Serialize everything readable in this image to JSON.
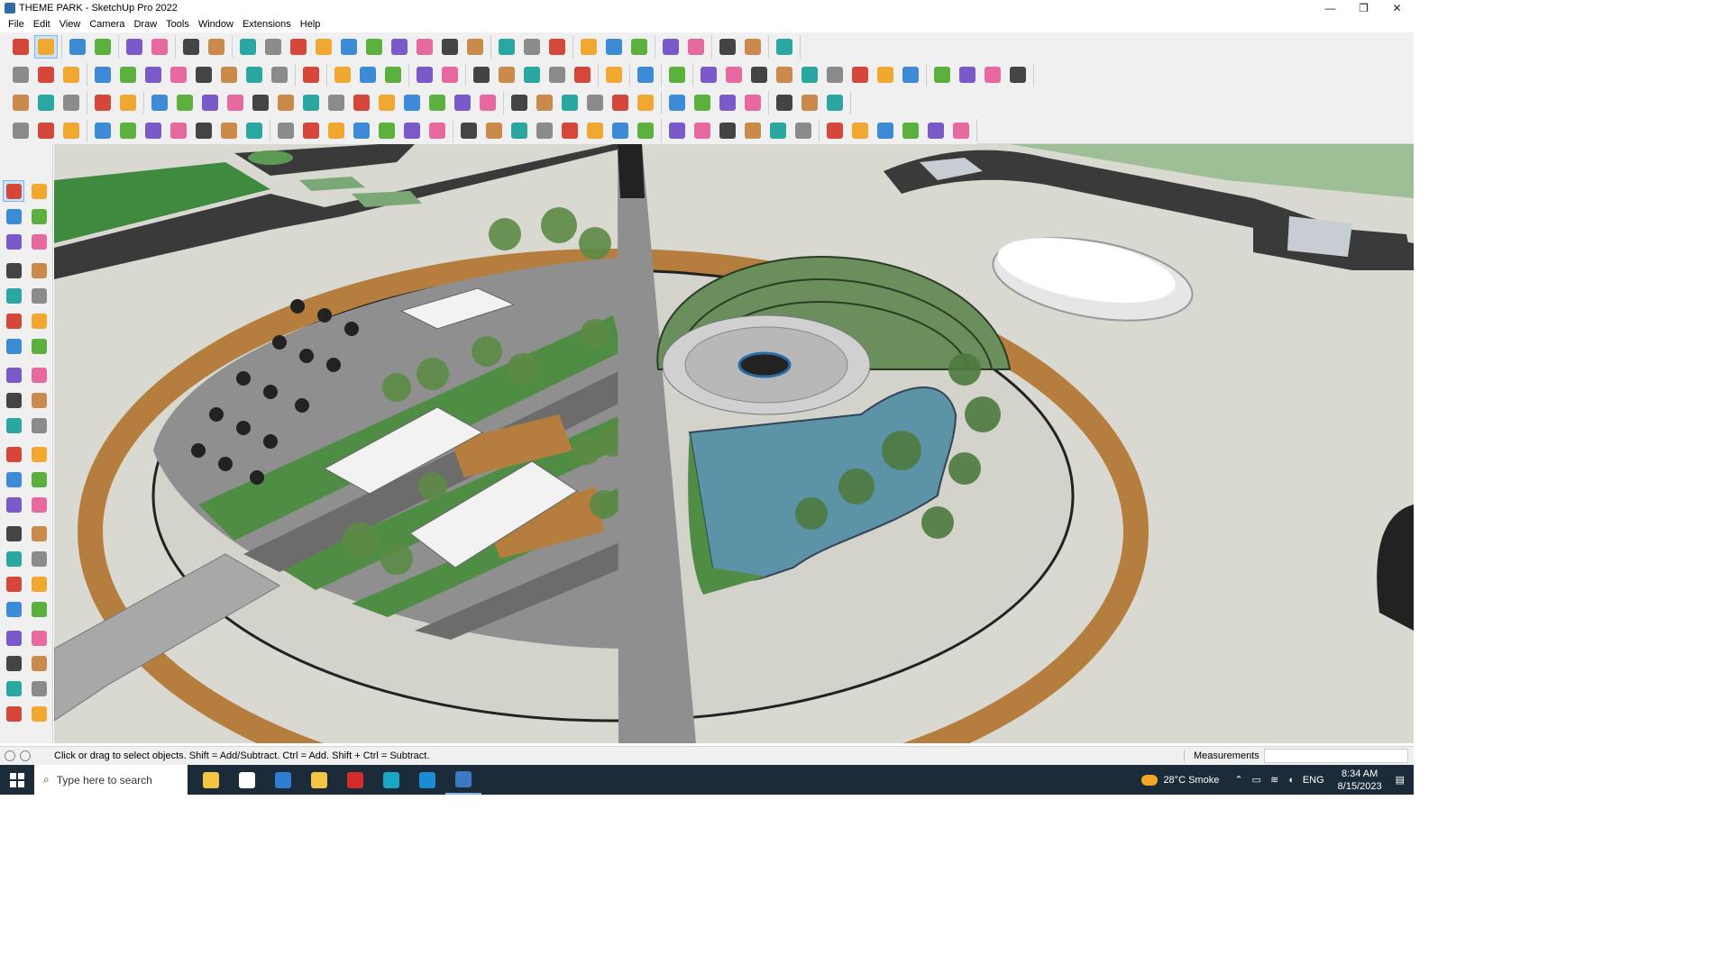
{
  "window": {
    "title": "THEME PARK - SketchUp Pro 2022",
    "minimize_glyph": "—",
    "restore_glyph": "❐",
    "close_glyph": "✕"
  },
  "menu": [
    "File",
    "Edit",
    "View",
    "Camera",
    "Draw",
    "Tools",
    "Window",
    "Extensions",
    "Help"
  ],
  "toolbar_colors": [
    "#d5463b",
    "#f0a830",
    "#3d8ad6",
    "#5bb03e",
    "#7a5ac8",
    "#e66aa0",
    "#444444",
    "#c98a4b",
    "#2aa7a0",
    "#8b8b8b"
  ],
  "left_tools": [
    "select-icon",
    "orbit-hand-icon",
    "paint-bucket-icon",
    "eraser-icon",
    "components-icon",
    "tag-icon",
    "line-icon",
    "freehand-icon",
    "rectangle-icon",
    "rotated-rectangle-icon",
    "circle-icon",
    "polygon-icon",
    "arc-icon",
    "two-point-arc-icon",
    "three-point-arc-icon",
    "pie-icon",
    "move-icon",
    "push-pull-icon",
    "rotate-icon",
    "follow-me-icon",
    "scale-icon",
    "offset-icon",
    "tape-measure-icon",
    "dimension-icon",
    "protractor-icon",
    "text-icon",
    "axes-icon",
    "3d-text-icon",
    "orbit-icon",
    "pan-icon",
    "zoom-icon",
    "zoom-window-icon",
    "zoom-extents-icon",
    "zoom-previous-icon",
    "position-camera-icon",
    "look-around-icon",
    "walk-icon",
    "section-plane-icon",
    "display-section-planes-icon",
    "display-section-cuts-icon",
    "section-fill-icon",
    "advanced-camera-icon"
  ],
  "status": {
    "hint": "Click or drag to select objects. Shift = Add/Subtract. Ctrl = Add. Shift + Ctrl = Subtract.",
    "measurements_label": "Measurements",
    "measurements_value": ""
  },
  "taskbar": {
    "search_placeholder": "Type here to search",
    "weather": "28°C  Smoke",
    "language": "ENG",
    "time": "8:34 AM",
    "date": "8/15/2023",
    "apps": [
      "file-explorer-icon",
      "task-view-icon",
      "calculator-icon",
      "folder-icon",
      "acrobat-icon",
      "app-icon",
      "edge-icon",
      "sketchup-icon"
    ]
  },
  "scene": {
    "ground_color": "#d9d9d2",
    "grass_color": "#4f8d45",
    "road_color": "#3a3a3a",
    "wood_color": "#b67e3e",
    "water_color": "#5c93a6"
  }
}
